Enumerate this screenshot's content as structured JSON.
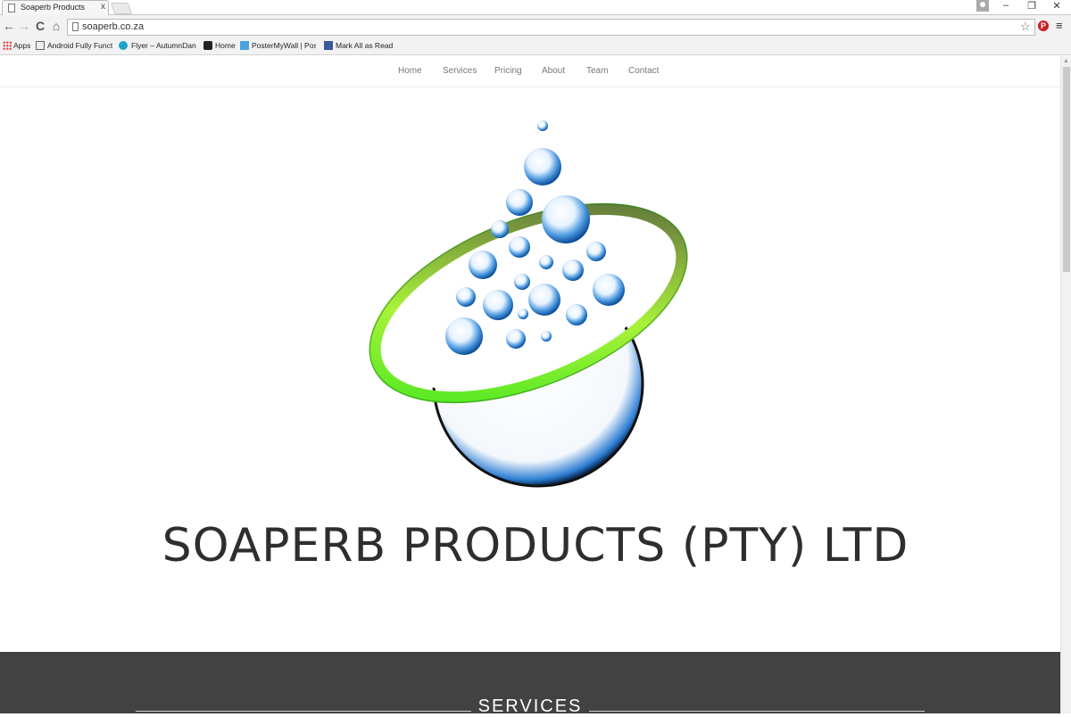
{
  "browser": {
    "tab_title": "Soaperb Products",
    "tab_close": "x",
    "url": "soaperb.co.za",
    "bookmarks": [
      {
        "label": "Apps",
        "icon": "apps-grid-icon"
      },
      {
        "label": "Android Fully Functio",
        "icon": "folder-icon"
      },
      {
        "label": "Flyer – AutumnDance",
        "icon": "circle-c-icon"
      },
      {
        "label": "Home",
        "icon": "b-square-icon"
      },
      {
        "label": "PosterMyWall | Poster",
        "icon": "postermywall-icon"
      },
      {
        "label": "Mark All as Read",
        "icon": "facebook-icon"
      }
    ]
  },
  "nav": {
    "items": [
      "Home",
      "Services",
      "Pricing",
      "About",
      "Team",
      "Contact"
    ]
  },
  "hero": {
    "company_name": "SOAPERB PRODUCTS (PTY) LTD"
  },
  "services": {
    "title": "SERVICES"
  },
  "colors": {
    "services_bg": "#424242",
    "ring_green": "#6bff3a",
    "bubble_blue": "#2b7fd0",
    "text_dark": "#2e2e2e"
  }
}
